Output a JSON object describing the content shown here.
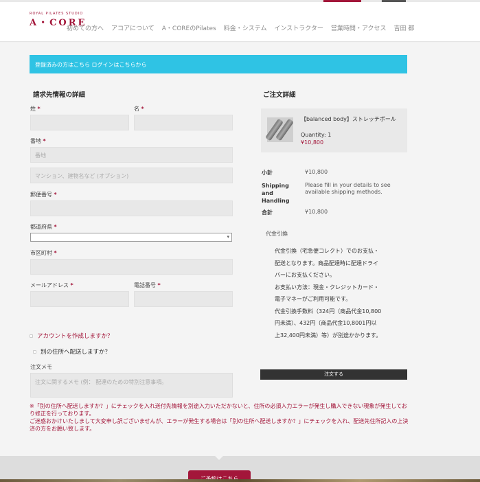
{
  "header": {
    "logo_small": "ROYAL PILATES STUDIO",
    "logo_main": "A・CORE",
    "nav": [
      "初めての方へ",
      "アコアについて",
      "A・COREのPilates",
      "料金・システム",
      "インストラクター",
      "営業時間・アクセス",
      "吉田 都"
    ]
  },
  "login_bar": "登録済みの方はこちら ログインはこちらから",
  "billing": {
    "title": "請求先情報の詳細",
    "last_name_label": "姓",
    "first_name_label": "名",
    "address_label": "番地",
    "address_placeholder": "番地",
    "address2_placeholder": "マンション、建物名など (オプション)",
    "postcode_label": "郵便番号",
    "state_label": "都道府県",
    "city_label": "市区町村",
    "email_label": "メールアドレス",
    "phone_label": "電話番号",
    "required_mark": "*",
    "create_account": "アカウントを作成しますか？",
    "ship_different": "別の住所へ配送しますか？",
    "notes_label": "注文メモ",
    "notes_placeholder": "注文に関するメモ (例： 配達のための特別注意事項。"
  },
  "notice": "※「別の住所へ配送しますか？」にチェックを入れ送付先情報を別途入力いただかないと、住所の必須入力エラーが発生し購入できない現象が発生しており修正を行っております。\nご迷惑おかけいたしまして大変申し訳ございませんが、エラーが発生する場合は「別の住所へ配送しますか？」にチェックを入れ、配送先住所記入の上決済の方をお願い致します。",
  "order": {
    "title": "ご注文詳細",
    "product_name": "【balanced body】ストレッチボール",
    "product_qty": "Quantity: 1",
    "product_price": "¥10,800",
    "subtotal_label": "小計",
    "subtotal_value": "¥10,800",
    "shipping_label": "Shipping and Handling",
    "shipping_value": "Please fill in your details to see available shipping methods.",
    "total_label": "合計",
    "total_value": "¥10,800",
    "payment_title": "代金引換",
    "payment_lines": [
      "代金引換（宅急便コレクト）でのお支払・",
      "配送となります。商品配達時に配達ドライ",
      "バーにお支払ください。",
      "お支払い方法：現金・クレジットカード・",
      "電子マネーがご利用可能です。",
      "代金引換手数料（324円（商品代金10,800",
      "円未満）、432円（商品代金10,8001円以",
      "上32,400円未満）等）が別途かかります。"
    ],
    "submit_button": "注文する"
  },
  "footer": {
    "button": "ご予約はこちら"
  },
  "colors": {
    "accent": "#a3163a",
    "info_bar": "#2fc3e4",
    "dark_button": "#333333"
  }
}
